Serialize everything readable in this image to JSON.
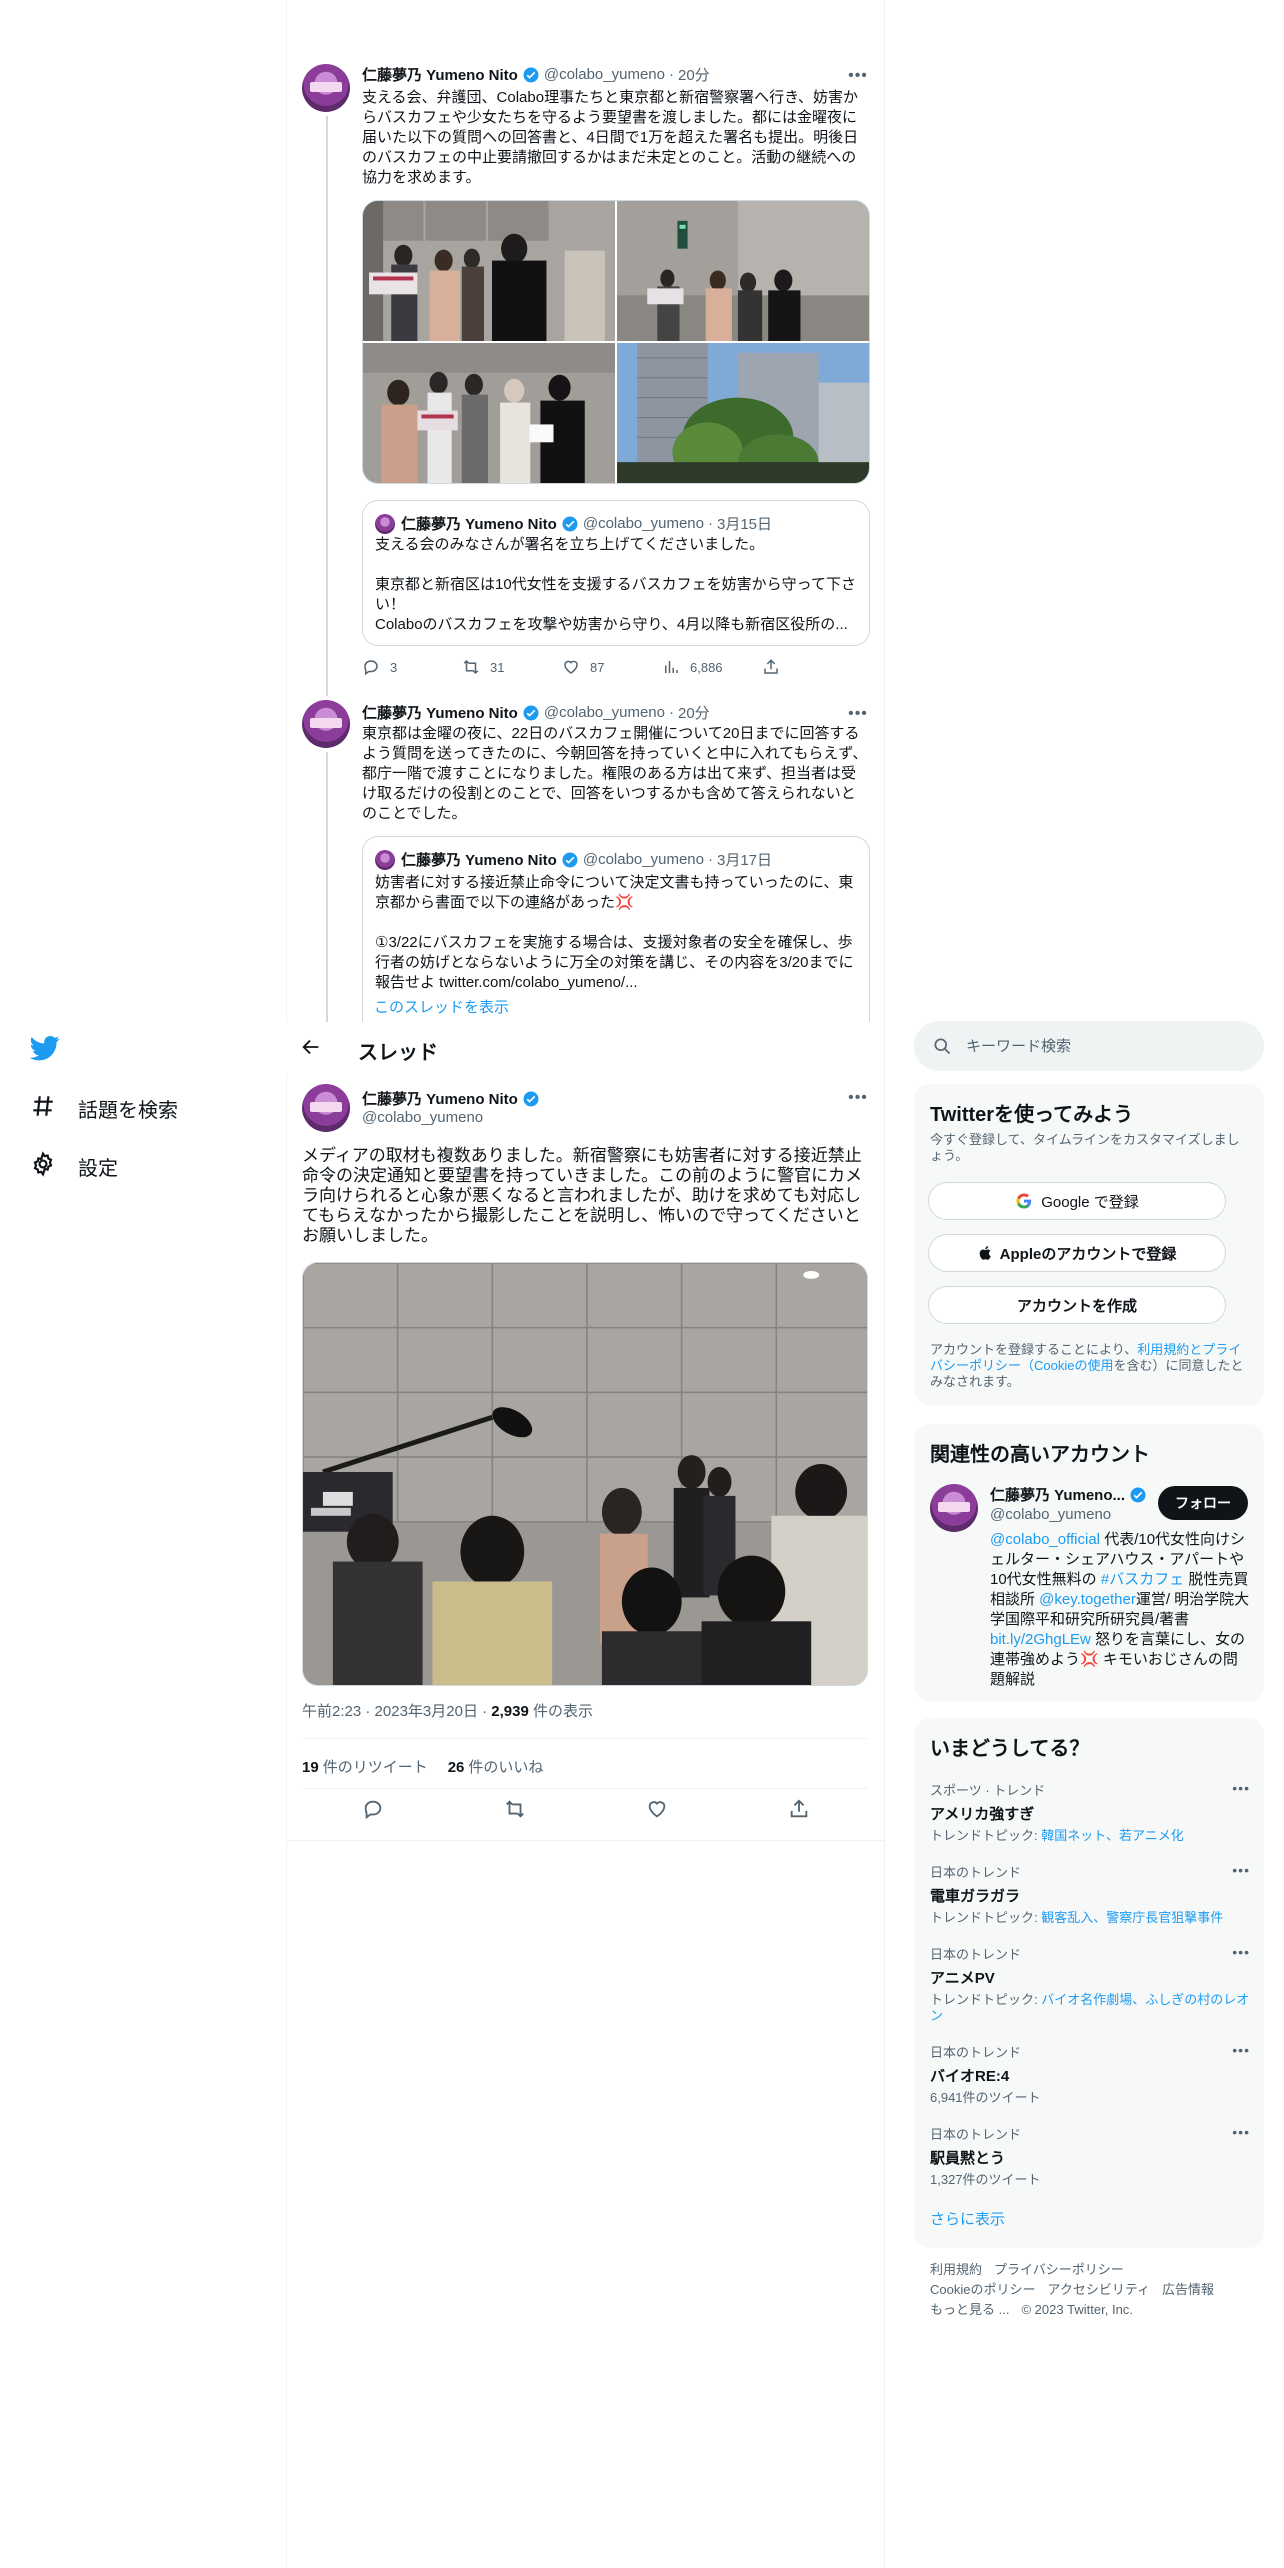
{
  "nav": {
    "explore_label": "話題を検索",
    "settings_label": "設定"
  },
  "colors": {
    "brand": "#1d9bf0",
    "text": "#0f1419",
    "muted": "#536471",
    "border": "#eff3f4"
  },
  "thread": {
    "title": "スレッド",
    "tweet1": {
      "name": "仁藤夢乃 Yumeno Nito",
      "handle": "@colabo_yumeno",
      "time": "20分",
      "text": "支える会、弁護団、Colabo理事たちと東京都と新宿警察署へ行き、妨害からバスカフェや少女たちを守るよう要望書を渡しました。都には金曜夜に届いた以下の質問への回答書と、4日間で1万を超えた署名も提出。明後日のバスカフェの中止要請撤回するかはまだ未定とのこと。活動の継続への協力を求めます。",
      "quote": {
        "name": "仁藤夢乃 Yumeno Nito",
        "handle": "@colabo_yumeno",
        "time": "3月15日",
        "text": "支える会のみなさんが署名を立ち上げてくださいました。\n\n東京都と新宿区は10代女性を支援するバスカフェを妨害から守って下さい！\nColaboのバスカフェを攻撃や妨害から守り、4月以降も新宿区役所の..."
      },
      "replies": "3",
      "retweets": "31",
      "likes": "87",
      "views": "6,886"
    },
    "tweet2": {
      "name": "仁藤夢乃 Yumeno Nito",
      "handle": "@colabo_yumeno",
      "time": "20分",
      "text": "東京都は金曜の夜に、22日のバスカフェ開催について20日までに回答するよう質問を送ってきたのに、今朝回答を持っていくと中に入れてもらえず、都庁一階で渡すことになりました。権限のある方は出て来ず、担当者は受け取るだけの役割とのことで、回答をいつするかも含めて答えられないとのことでした。",
      "quote": {
        "name": "仁藤夢乃 Yumeno Nito",
        "handle": "@colabo_yumeno",
        "time": "3月17日",
        "text": "妨害者に対する接近禁止命令について決定文書も持っていったのに、東京都から書面で以下の連絡があった💢\n\n①3/22にバスカフェを実施する場合は、支援対象者の安全を確保し、歩行者の妨げとならないように万全の対策を講じ、その内容を3/20までに報告せよ twitter.com/colabo_yumeno/..."
      },
      "show_thread": "このスレッドを表示"
    },
    "main": {
      "name": "仁藤夢乃 Yumeno Nito",
      "handle": "@colabo_yumeno",
      "text": "メディアの取材も複数ありました。新宿警察にも妨害者に対する接近禁止命令の決定通知と要望書を持っていきました。この前のように警官にカメラ向けられると心象が悪くなると言われましたが、助けを求めても対応してもらえなかったから撮影したことを説明し、怖いので守ってくださいとお願いしました。",
      "time": "午前2:23",
      "date": "2023年3月20日",
      "views_count": "2,939",
      "views_label": "件の表示",
      "retweet_count": "19",
      "retweet_label": "件のリツイート",
      "like_count": "26",
      "like_label": "件のいいね"
    }
  },
  "right": {
    "search_placeholder": "キーワード検索",
    "signup": {
      "title": "Twitterを使ってみよう",
      "subtitle": "今すぐ登録して、タイムラインをカスタマイズしましょう。",
      "google": "Google で登録",
      "apple": "Appleのアカウントで登録",
      "create": "アカウントを作成",
      "terms_prefix": "アカウントを登録することにより、",
      "terms_link": "利用規約とプライバシーポリシー（Cookieの使用",
      "terms_suffix": "を含む）に同意したとみなされます。"
    },
    "related": {
      "title": "関連性の高いアカウント",
      "name": "仁藤夢乃 Yumeno...",
      "handle": "@colabo_yumeno",
      "follow": "フォロー",
      "bio_link1": "@colabo_official",
      "bio_text1": " 代表/10代女性向けシェルター・シェアハウス・アパートや10代女性無料の ",
      "bio_link2": "#バスカフェ",
      "bio_text2": " 脱性売買相談所 ",
      "bio_link3": "@key.together",
      "bio_text3": "運営/ 明治学院大学国際平和研究所研究員/著書",
      "bio_link4": "bit.ly/2GhgLEw",
      "bio_text4": " 怒りを言葉にし、女の連帯強めよう💢 キモいおじさんの問題解説"
    },
    "trends": {
      "title": "いまどうしてる？",
      "items": [
        {
          "cat": "スポーツ · トレンド",
          "name": "アメリカ強すぎ",
          "sub_prefix": "トレンドトピック: ",
          "sub": "韓国ネット、若アニメ化"
        },
        {
          "cat": "日本のトレンド",
          "name": "電車ガラガラ",
          "sub_prefix": "トレンドトピック: ",
          "sub": "観客乱入、警察庁長官狙撃事件"
        },
        {
          "cat": "日本のトレンド",
          "name": "アニメPV",
          "sub_prefix": "トレンドトピック: ",
          "sub": "バイオ名作劇場、ふしぎの村のレオン"
        },
        {
          "cat": "日本のトレンド",
          "name": "バイオRE:4",
          "sub_prefix": "",
          "sub": "6,941件のツイート"
        },
        {
          "cat": "日本のトレンド",
          "name": "駅員黙とう",
          "sub_prefix": "",
          "sub": "1,327件のツイート"
        }
      ],
      "show_more": "さらに表示"
    },
    "footer": {
      "terms": "利用規約",
      "privacy": "プライバシーポリシー",
      "cookie": "Cookieのポリシー",
      "accessibility": "アクセシビリティ",
      "ads": "広告情報",
      "more": "もっと見る ...",
      "copyright": "© 2023 Twitter, Inc."
    }
  }
}
